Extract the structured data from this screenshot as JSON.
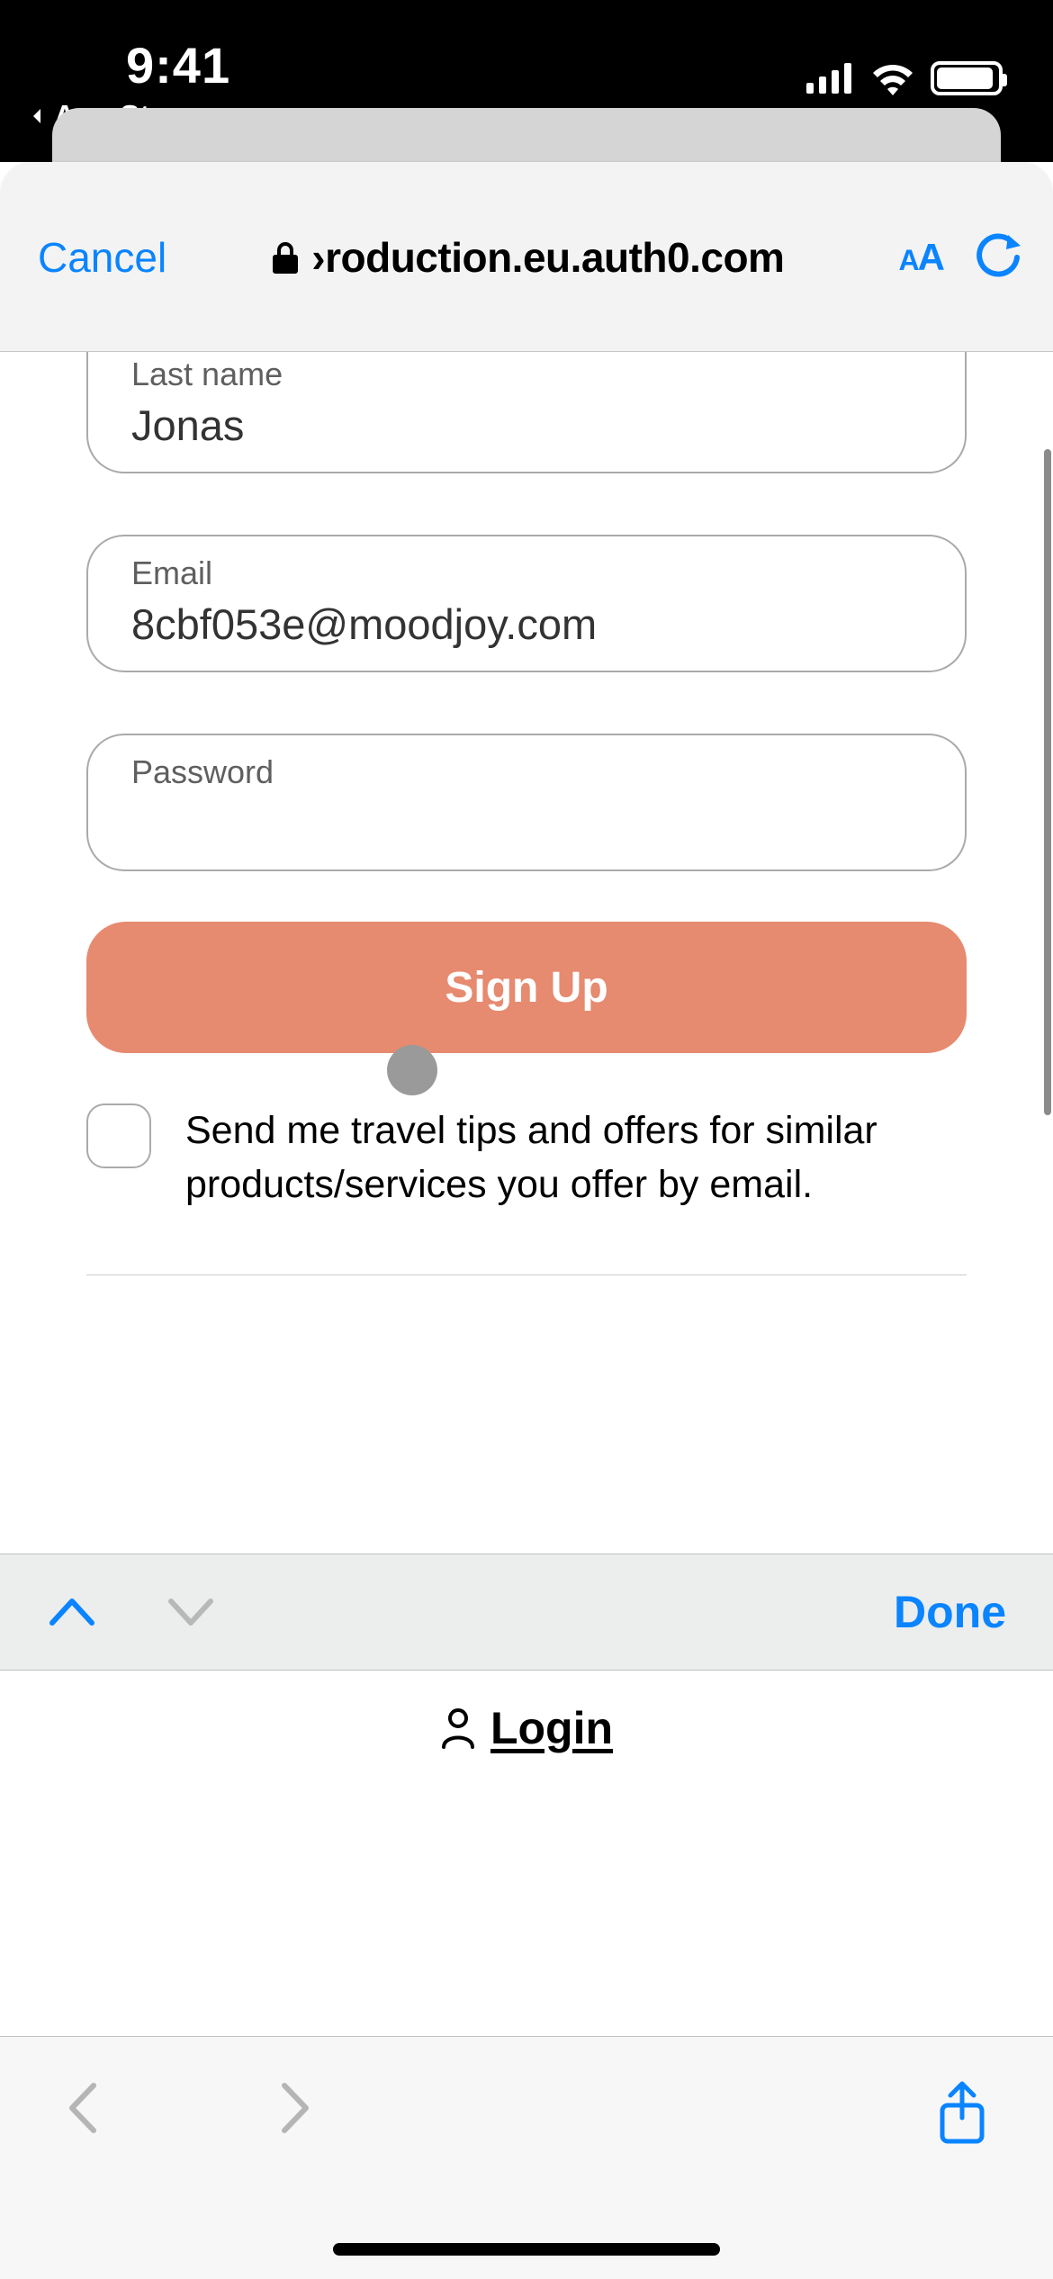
{
  "status_bar": {
    "time": "9:41",
    "back_label": "App Store"
  },
  "safari": {
    "cancel_label": "Cancel",
    "url_display": "›roduction.eu.auth0.com",
    "aa_small": "A",
    "aa_big": "A"
  },
  "form": {
    "last_name": {
      "label": "Last name",
      "value": "Jonas"
    },
    "email": {
      "label": "Email",
      "value": "8cbf053e@moodjoy.com"
    },
    "password": {
      "label": "Password",
      "value": ""
    },
    "signup_label": "Sign Up",
    "checkbox_label": "Send me travel tips and offers for similar products/services you offer by email."
  },
  "keyboard": {
    "done_label": "Done"
  },
  "login": {
    "label": "Login"
  },
  "colors": {
    "accent_blue": "#0a84ff",
    "signup_orange": "#e68a70"
  }
}
